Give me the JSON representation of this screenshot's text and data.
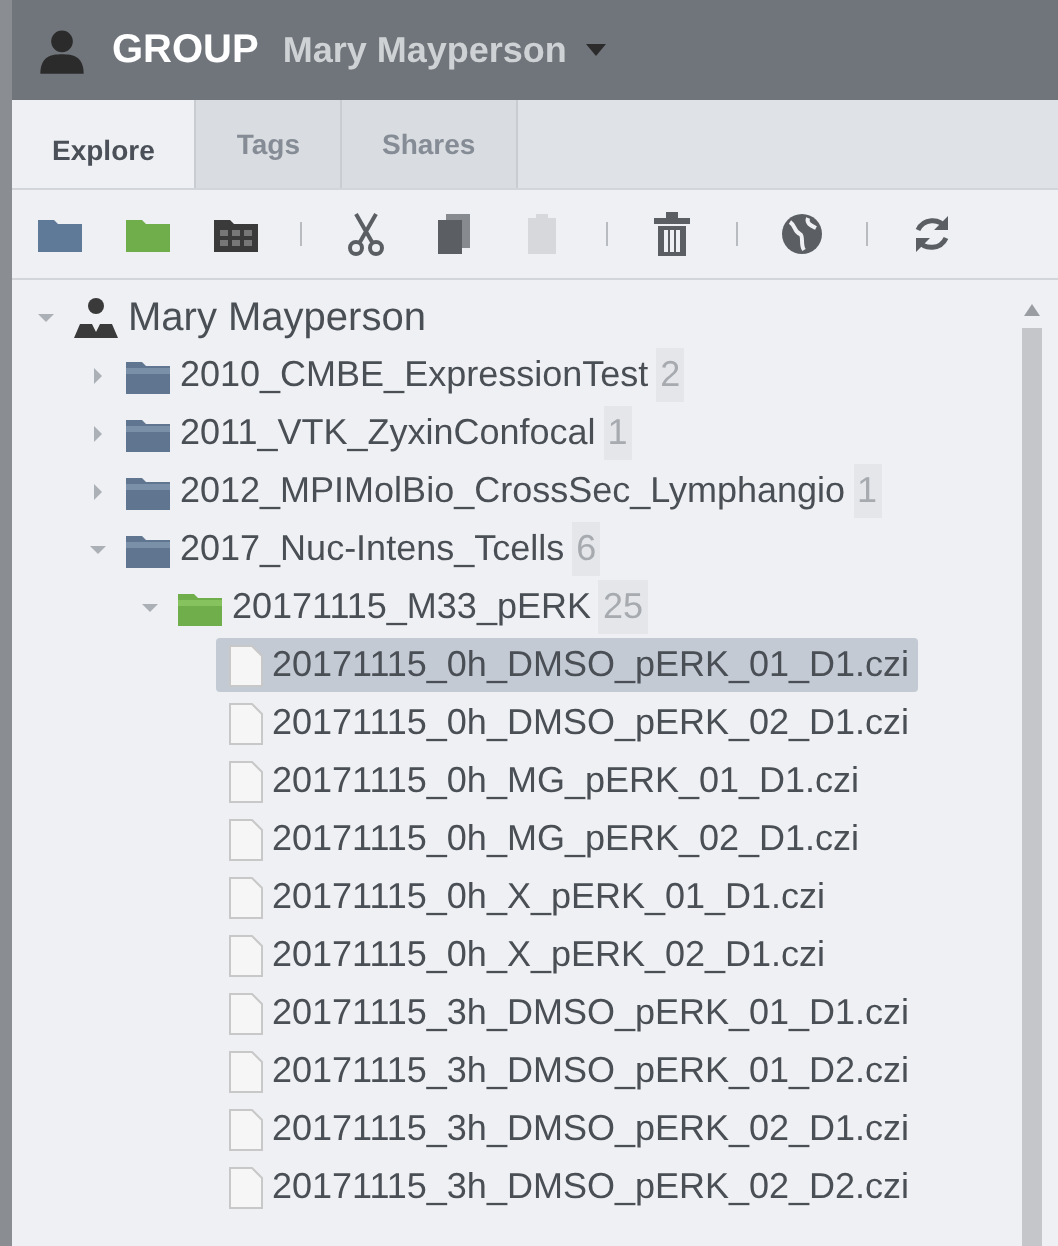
{
  "header": {
    "group_label": "GROUP",
    "group_name": "Mary Mayperson"
  },
  "tabs": [
    {
      "label": "Explore",
      "selected": true
    },
    {
      "label": "Tags",
      "selected": false
    },
    {
      "label": "Shares",
      "selected": false
    }
  ],
  "toolbar": [
    {
      "kind": "project",
      "disabled": false
    },
    {
      "kind": "dataset",
      "disabled": false
    },
    {
      "kind": "screen",
      "disabled": false
    },
    {
      "kind": "separator"
    },
    {
      "kind": "cut",
      "disabled": false
    },
    {
      "kind": "copy",
      "disabled": false
    },
    {
      "kind": "paste",
      "disabled": true
    },
    {
      "kind": "separator"
    },
    {
      "kind": "delete",
      "disabled": false
    },
    {
      "kind": "separator"
    },
    {
      "kind": "share",
      "disabled": false
    },
    {
      "kind": "separator"
    },
    {
      "kind": "refresh",
      "disabled": false
    }
  ],
  "tree": [
    {
      "kind": "user",
      "name": "Mary Mayperson",
      "expanded": true,
      "selected": false,
      "children": [
        {
          "kind": "project",
          "name": "2010_CMBE_ExpressionTest",
          "count": "2",
          "expanded": false,
          "selected": false
        },
        {
          "kind": "project",
          "name": "2011_VTK_ZyxinConfocal",
          "count": "1",
          "expanded": false,
          "selected": false
        },
        {
          "kind": "project",
          "name": "2012_MPIMolBio_CrossSec_Lymphangio",
          "count": "1",
          "expanded": false,
          "selected": false
        },
        {
          "kind": "project",
          "name": "2017_Nuc-Intens_Tcells",
          "count": "6",
          "expanded": true,
          "selected": false,
          "children": [
            {
              "kind": "dataset",
              "name": "20171115_M33_pERK",
              "count": "25",
              "expanded": true,
              "selected": false,
              "children": [
                {
                  "kind": "image",
                  "name": "20171115_0h_DMSO_pERK_01_D1.czi",
                  "selected": true
                },
                {
                  "kind": "image",
                  "name": "20171115_0h_DMSO_pERK_02_D1.czi",
                  "selected": false
                },
                {
                  "kind": "image",
                  "name": "20171115_0h_MG_pERK_01_D1.czi",
                  "selected": false
                },
                {
                  "kind": "image",
                  "name": "20171115_0h_MG_pERK_02_D1.czi",
                  "selected": false
                },
                {
                  "kind": "image",
                  "name": "20171115_0h_X_pERK_01_D1.czi",
                  "selected": false
                },
                {
                  "kind": "image",
                  "name": "20171115_0h_X_pERK_02_D1.czi",
                  "selected": false
                },
                {
                  "kind": "image",
                  "name": "20171115_3h_DMSO_pERK_01_D1.czi",
                  "selected": false
                },
                {
                  "kind": "image",
                  "name": "20171115_3h_DMSO_pERK_01_D2.czi",
                  "selected": false
                },
                {
                  "kind": "image",
                  "name": "20171115_3h_DMSO_pERK_02_D1.czi",
                  "selected": false
                },
                {
                  "kind": "image",
                  "name": "20171115_3h_DMSO_pERK_02_D2.czi",
                  "selected": false
                }
              ]
            }
          ]
        }
      ]
    }
  ]
}
